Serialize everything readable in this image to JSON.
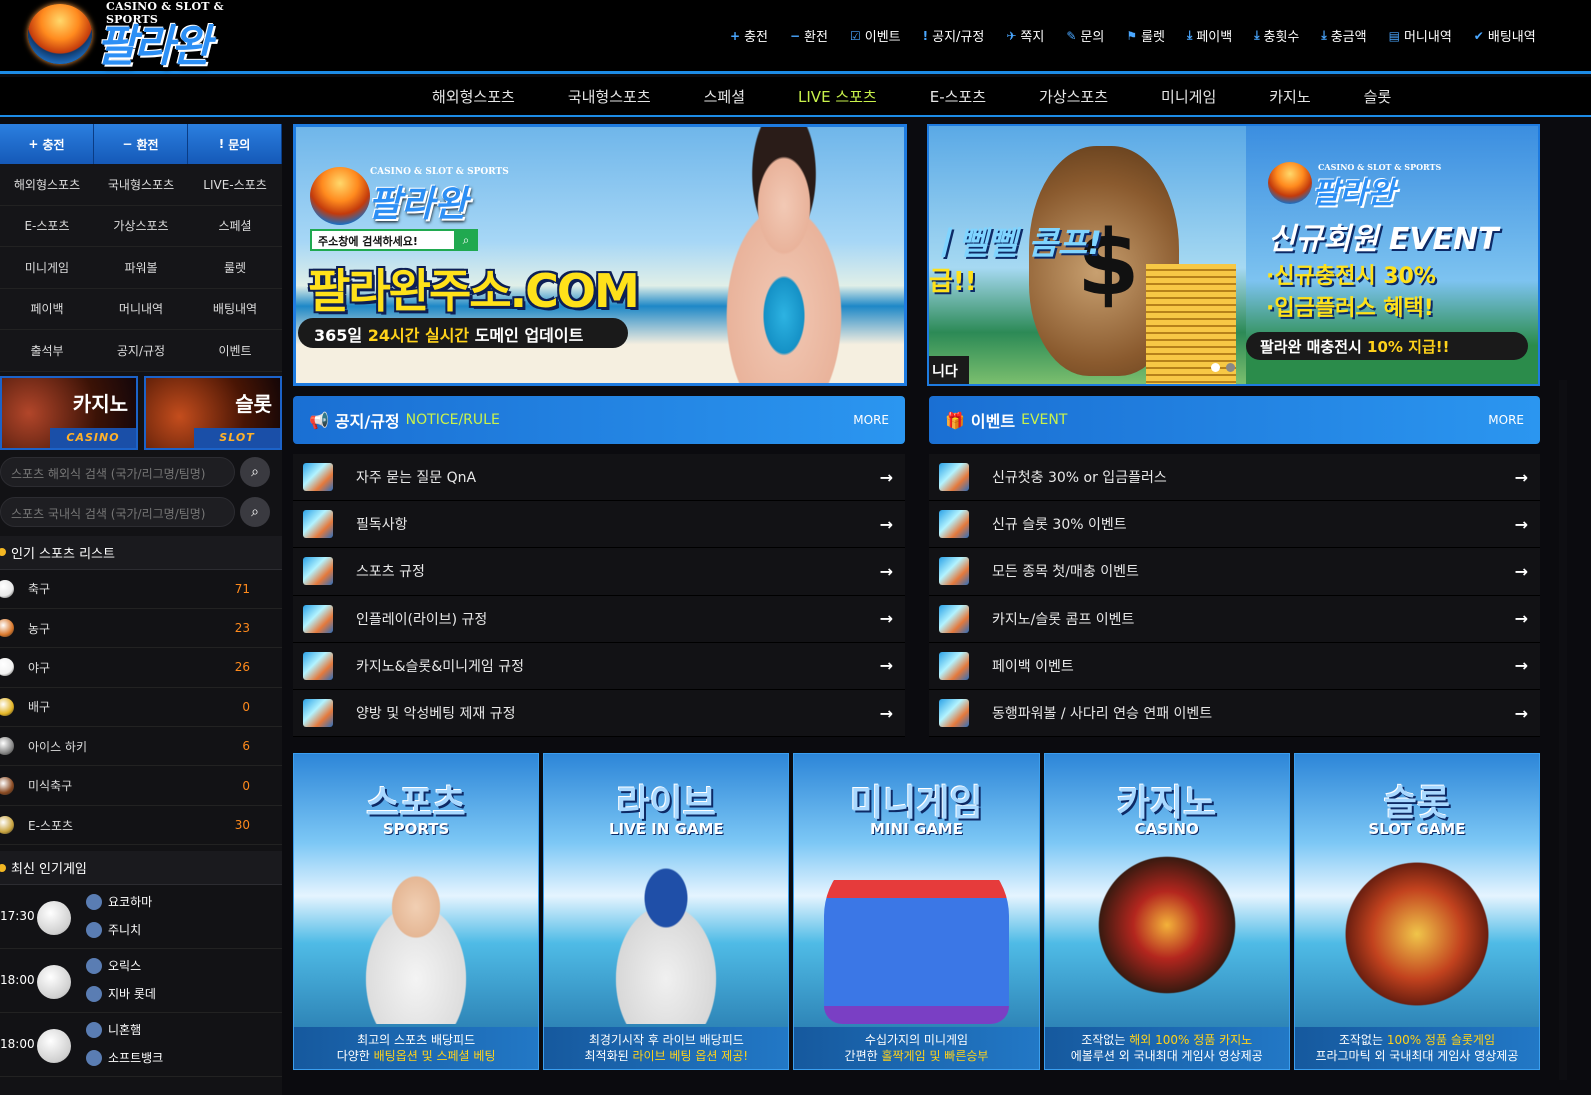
{
  "brand": {
    "tagline": "CASINO & SLOT & SPORTS",
    "name": "팔라완"
  },
  "topnav": [
    {
      "icon": "+",
      "label": "충전"
    },
    {
      "icon": "−",
      "label": "환전"
    },
    {
      "icon": "☑",
      "label": "이벤트"
    },
    {
      "icon": "!",
      "label": "공지/규정"
    },
    {
      "icon": "✈",
      "label": "쪽지"
    },
    {
      "icon": "✎",
      "label": "문의"
    },
    {
      "icon": "⚑",
      "label": "룰렛"
    },
    {
      "icon": "⤓",
      "label": "페이백"
    },
    {
      "icon": "⤓",
      "label": "충횟수"
    },
    {
      "icon": "⤓",
      "label": "충금액"
    },
    {
      "icon": "▤",
      "label": "머니내역"
    },
    {
      "icon": "✔",
      "label": "배팅내역"
    }
  ],
  "mainnav": [
    "해외형스포츠",
    "국내형스포츠",
    "스페셜",
    "LIVE 스포츠",
    "E-스포츠",
    "가상스포츠",
    "미니게임",
    "카지노",
    "슬롯"
  ],
  "mainnav_active": "LIVE 스포츠",
  "sidebar": {
    "quick": [
      {
        "icon": "+",
        "label": "충전"
      },
      {
        "icon": "−",
        "label": "환전"
      },
      {
        "icon": "!",
        "label": "문의"
      }
    ],
    "menu": [
      "해외형스포츠",
      "국내형스포츠",
      "LIVE-스포츠",
      "E-스포츠",
      "가상스포츠",
      "스페셜",
      "미니게임",
      "파워볼",
      "룰렛",
      "페이백",
      "머니내역",
      "배팅내역",
      "출석부",
      "공지/규정",
      "이벤트"
    ],
    "promo": [
      {
        "title": "카지노",
        "tag": "CASINO"
      },
      {
        "title": "슬롯",
        "tag": "SLOT"
      }
    ],
    "search": [
      "스포츠 해외식 검색 (국가/리그명/팀명)",
      "스포츠 국내식 검색 (국가/리그명/팀명)"
    ],
    "popular_title": "인기 스포츠 리스트",
    "sports": [
      {
        "name": "축구",
        "count": "71",
        "color": "#e8e8e8"
      },
      {
        "name": "농구",
        "count": "23",
        "color": "#d9782c"
      },
      {
        "name": "야구",
        "count": "26",
        "color": "#f2f2f2"
      },
      {
        "name": "배구",
        "count": "0",
        "color": "#e3b526"
      },
      {
        "name": "아이스 하키",
        "count": "6",
        "color": "#888888"
      },
      {
        "name": "미식축구",
        "count": "0",
        "color": "#8a4a22"
      },
      {
        "name": "E-스포츠",
        "count": "30",
        "color": "#c9a440"
      }
    ],
    "latest_title": "최신 인기게임",
    "games": [
      {
        "time": "17:30",
        "home": "요코하마",
        "away": "주니치"
      },
      {
        "time": "18:00",
        "home": "오릭스",
        "away": "지바 롯데"
      },
      {
        "time": "18:00",
        "home": "니혼햄",
        "away": "소프트뱅크"
      }
    ]
  },
  "banner1": {
    "tagline": "CASINO & SLOT & SPORTS",
    "name": "팔라완",
    "search": "주소창에 검색하세요!",
    "domain": "팔라완주소.COM",
    "bar_a": "365일 ",
    "bar_b": "24시간 실시간",
    "bar_c": " 도메인 업데이트"
  },
  "banner2": {
    "left_title": "ㅣ뻴뻴 콤프!",
    "left_sub": "급!!",
    "left_bar": "니다",
    "tagline": "CASINO & SLOT & SPORTS",
    "name": "팔라완",
    "event": "신규회원 EVENT",
    "line1": "·신규충전시 30%",
    "line2": "·입금플러스 혜택!",
    "bar_a": "팔라완 매충전시 ",
    "bar_b": "10% 지급!!"
  },
  "notice": {
    "title": "공지/규정",
    "en": "NOTICE/RULE",
    "more": "MORE",
    "items": [
      "자주 묻는 질문 QnA",
      "필독사항",
      "스포츠 규정",
      "인플레이(라이브) 규정",
      "카지노&슬롯&미니게임 규정",
      "양방 및 악성베팅 제재 규정"
    ]
  },
  "event": {
    "title": "이벤트",
    "en": "EVENT",
    "more": "MORE",
    "items": [
      "신규첫충 30% or 입금플러스",
      "신규 슬롯 30% 이벤트",
      "모든 종목 첫/매충 이벤트",
      "카지노/슬롯 콤프 이벤트",
      "페이백 이벤트",
      "동행파워볼 / 사다리 연승 연패 이벤트"
    ]
  },
  "cards": [
    {
      "title": "스포츠",
      "en": "SPORTS",
      "cap1": "최고의 스포츠 배당피드",
      "cap2a": "다양한 ",
      "cap2b": "배팅옵션 및 스페셜 베팅",
      "cap2c": ""
    },
    {
      "title": "라이브",
      "en": "LIVE IN GAME",
      "cap1": "최경기시작 후 라이브 배당피드",
      "cap2a": "최적화된 ",
      "cap2b": "라이브 베팅 옵션 제공!",
      "cap2c": ""
    },
    {
      "title": "미니게임",
      "en": "MINI GAME",
      "cap1": "수십가지의 미니게임",
      "cap2a": "간편한 ",
      "cap2b": "홀짝게임 및 빠른승부",
      "cap2c": ""
    },
    {
      "title": "카지노",
      "en": "CASINO",
      "cap1a": "조작없는 ",
      "cap1b": "해외 100% 정품 카지노",
      "cap2a": "에볼루션 외 국내최대 게임사 영상제공",
      "cap2b": "",
      "cap2c": ""
    },
    {
      "title": "슬롯",
      "en": "SLOT GAME",
      "cap1a": "조작없는 ",
      "cap1b": "100% 정품 슬롯게임",
      "cap2a": "프라그마틱 외 국내최대 게임사 영상제공",
      "cap2b": "",
      "cap2c": ""
    }
  ]
}
